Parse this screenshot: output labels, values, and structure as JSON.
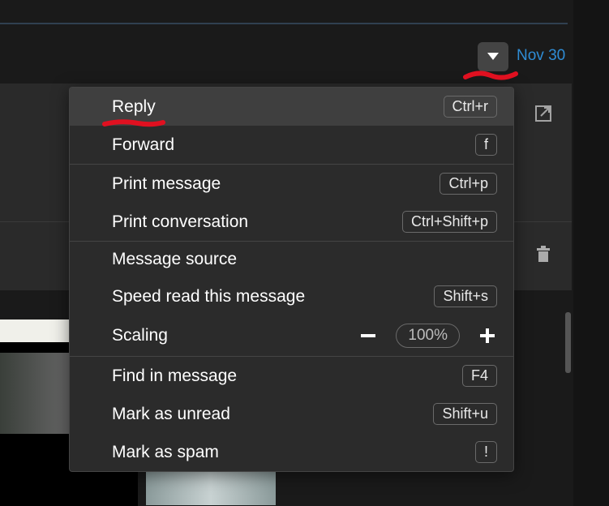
{
  "header": {
    "date": "Nov 30"
  },
  "menu": {
    "groups": [
      [
        {
          "id": "reply",
          "label": "Reply",
          "shortcut": "Ctrl+r",
          "hover": true
        },
        {
          "id": "forward",
          "label": "Forward",
          "shortcut": "f"
        }
      ],
      [
        {
          "id": "print-msg",
          "label": "Print message",
          "shortcut": "Ctrl+p"
        },
        {
          "id": "print-conv",
          "label": "Print conversation",
          "shortcut": "Ctrl+Shift+p"
        }
      ],
      [
        {
          "id": "msg-src",
          "label": "Message source",
          "shortcut": ""
        },
        {
          "id": "speed-read",
          "label": "Speed read this message",
          "shortcut": "Shift+s"
        },
        {
          "id": "scaling",
          "label": "Scaling",
          "zoom": "100%",
          "scaling_row": true
        }
      ],
      [
        {
          "id": "find",
          "label": "Find in message",
          "shortcut": "F4"
        },
        {
          "id": "unread",
          "label": "Mark as unread",
          "shortcut": "Shift+u"
        },
        {
          "id": "spam",
          "label": "Mark as spam",
          "shortcut": "!"
        }
      ]
    ]
  }
}
